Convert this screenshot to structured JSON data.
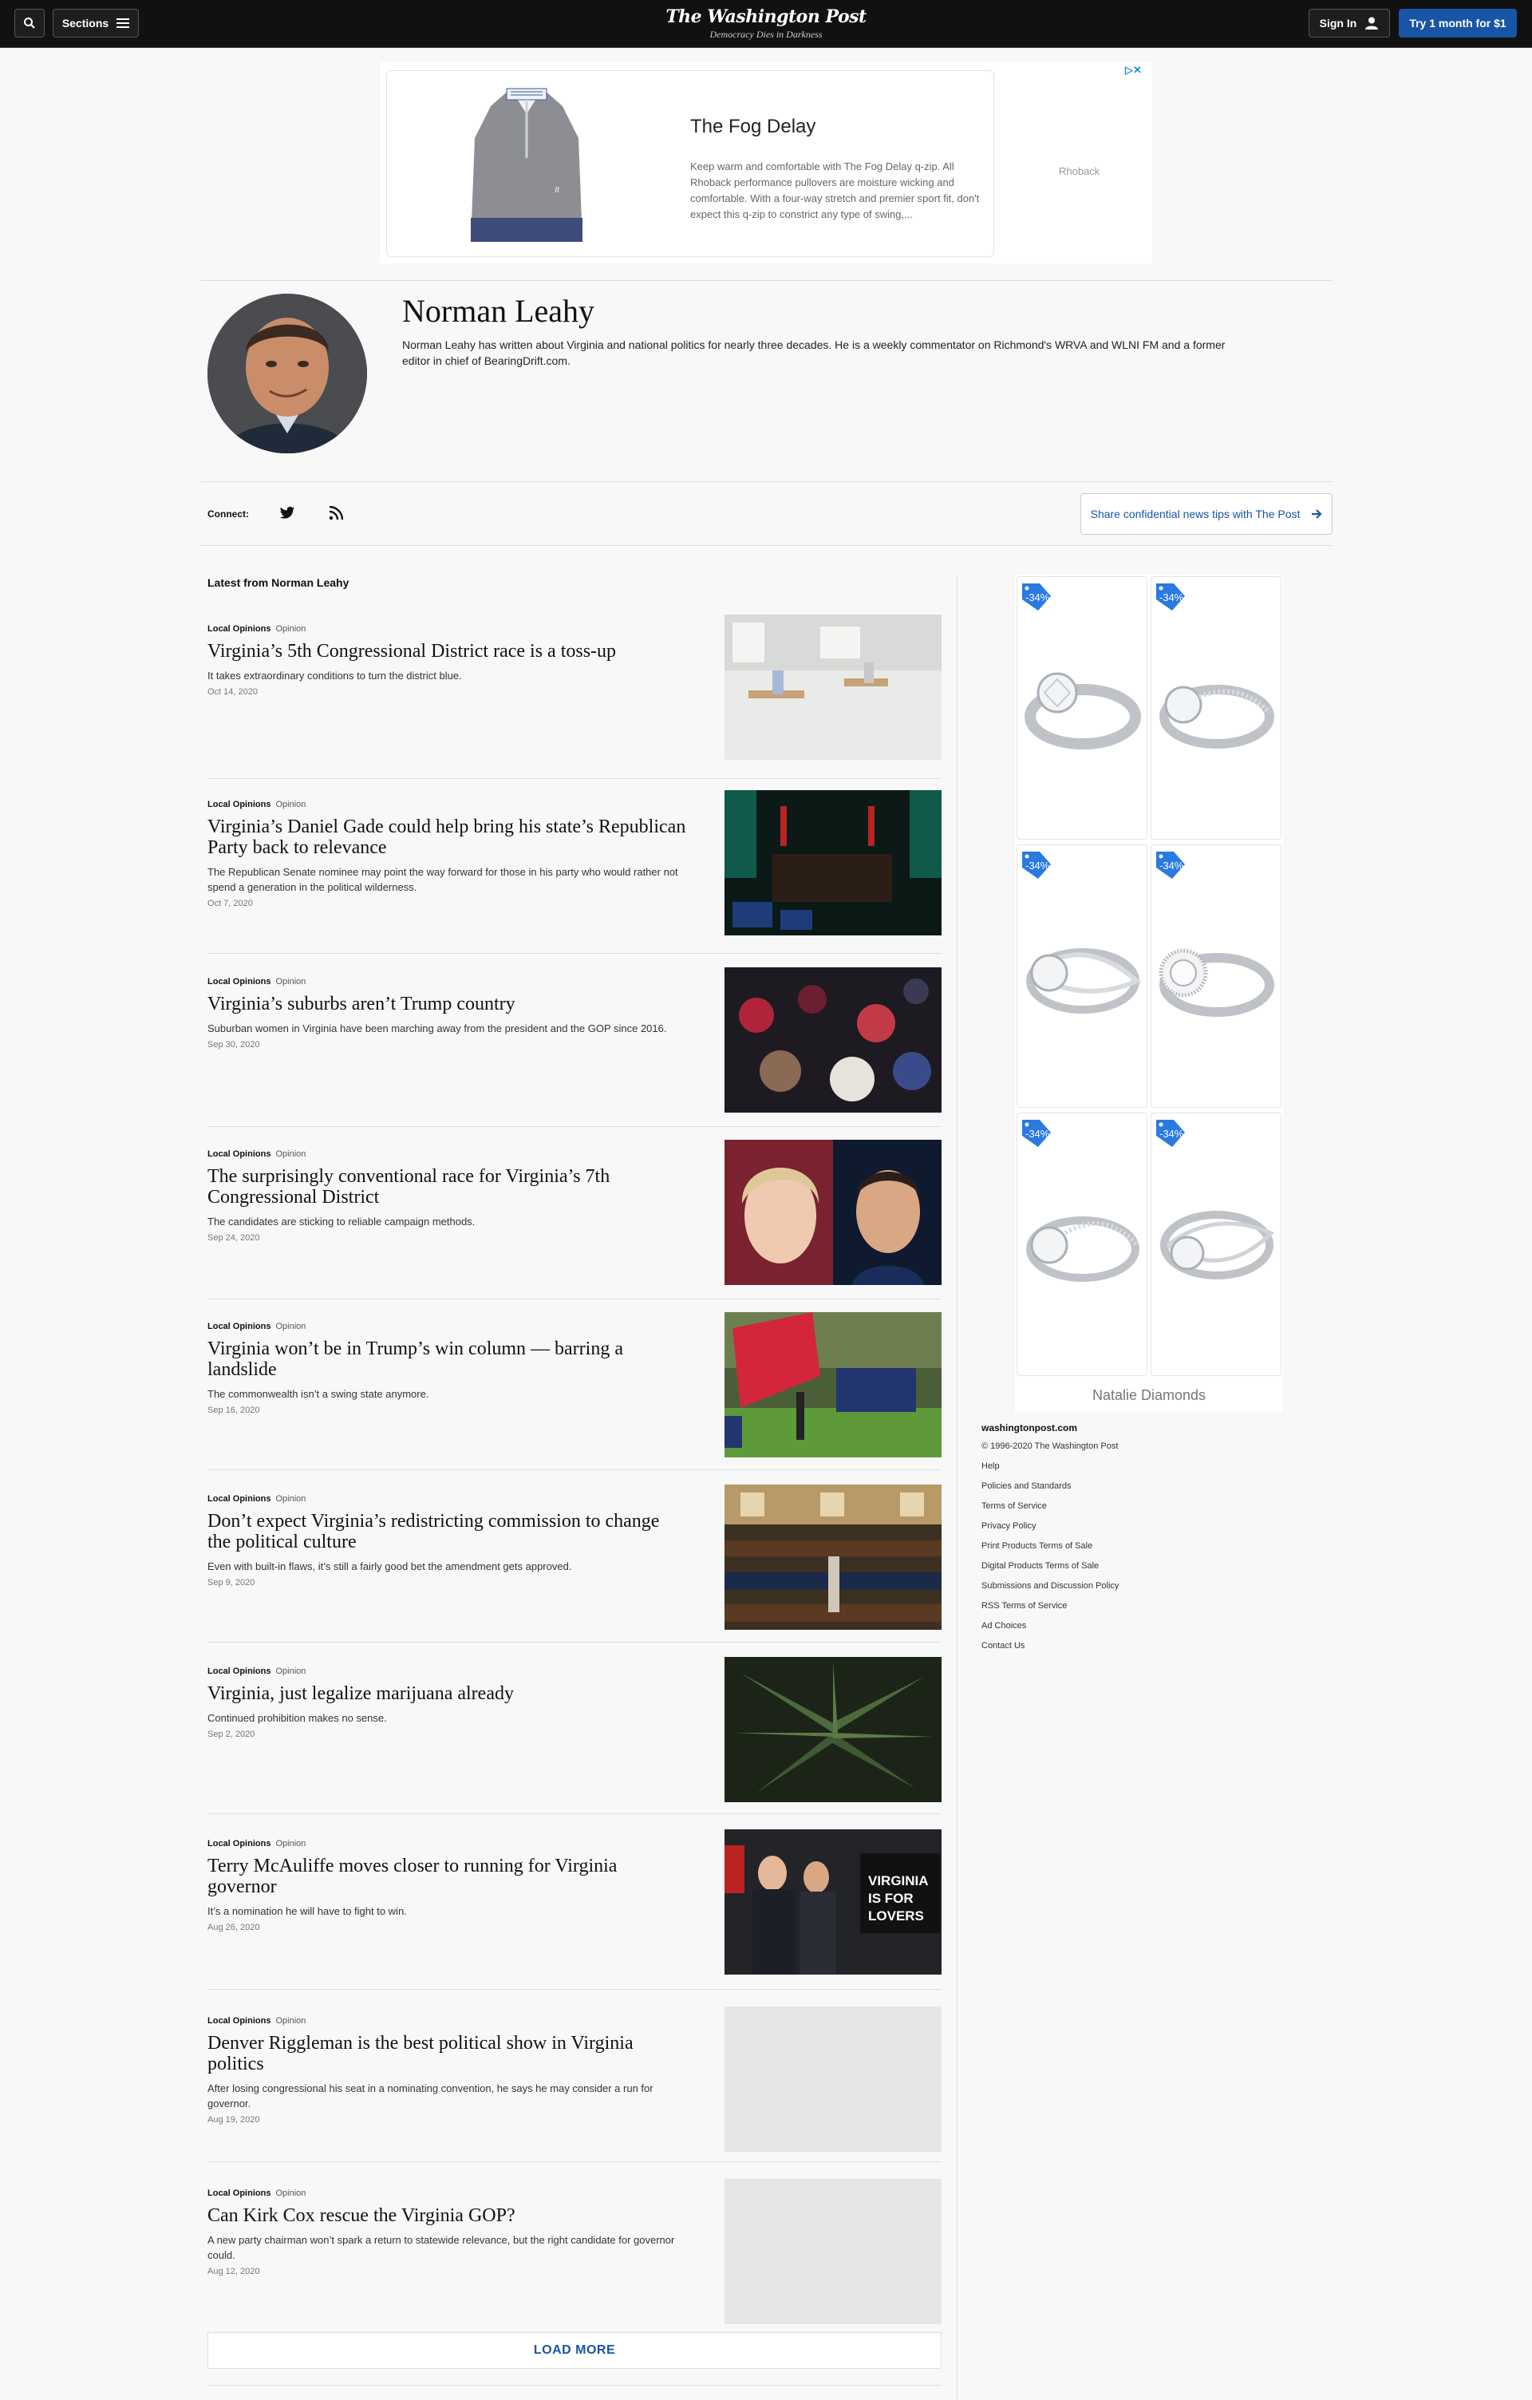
{
  "header": {
    "sections_label": "Sections",
    "logo_name": "The Washington Post",
    "logo_tagline": "Democracy Dies in Darkness",
    "signin_label": "Sign In",
    "try_label": "Try 1 month for $1"
  },
  "top_ad": {
    "title": "The Fog Delay",
    "description": "Keep warm and comfortable with The Fog Delay q-zip. All Rhoback performance pullovers are moisture wicking and comfortable. With a four-way stretch and premier sport fit, don't expect this q-zip to constrict any type of swing,...",
    "brand": "Rhoback"
  },
  "author": {
    "name": "Norman Leahy",
    "bio": "Norman Leahy has written about Virginia and national politics for nearly three decades. He is a weekly commentator on Richmond's WRVA and WLNI FM and a former editor in chief of BearingDrift.com."
  },
  "connect": {
    "label": "Connect:",
    "tips_label": "Share confidential news tips with The Post"
  },
  "latest_heading": "Latest from Norman Leahy",
  "articles": [
    {
      "section": "Local Opinions",
      "kind": "Opinion",
      "headline": "Virginia’s 5th Congressional District race is a toss-up",
      "blurb": "It takes extraordinary conditions to turn the district blue.",
      "date": "Oct 14, 2020"
    },
    {
      "section": "Local Opinions",
      "kind": "Opinion",
      "headline": "Virginia’s Daniel Gade could help bring his state’s Republican Party back to relevance",
      "blurb": "The Republican Senate nominee may point the way forward for those in his party who would rather not spend a generation in the political wilderness.",
      "date": "Oct 7, 2020"
    },
    {
      "section": "Local Opinions",
      "kind": "Opinion",
      "headline": "Virginia’s suburbs aren’t Trump country",
      "blurb": "Suburban women in Virginia have been marching away from the president and the GOP since 2016.",
      "date": "Sep 30, 2020"
    },
    {
      "section": "Local Opinions",
      "kind": "Opinion",
      "headline": "The surprisingly conventional race for Virginia’s 7th Congressional District",
      "blurb": "The candidates are sticking to reliable campaign methods.",
      "date": "Sep 24, 2020"
    },
    {
      "section": "Local Opinions",
      "kind": "Opinion",
      "headline": "Virginia won’t be in Trump’s win column — barring a landslide",
      "blurb": "The commonwealth isn’t a swing state anymore.",
      "date": "Sep 16, 2020"
    },
    {
      "section": "Local Opinions",
      "kind": "Opinion",
      "headline": "Don’t expect Virginia’s redistricting commission to change the political culture",
      "blurb": "Even with built-in flaws, it’s still a fairly good bet the amendment gets approved.",
      "date": "Sep 9, 2020"
    },
    {
      "section": "Local Opinions",
      "kind": "Opinion",
      "headline": "Virginia, just legalize marijuana already",
      "blurb": "Continued prohibition makes no sense.",
      "date": "Sep 2, 2020"
    },
    {
      "section": "Local Opinions",
      "kind": "Opinion",
      "headline": "Terry McAuliffe moves closer to running for Virginia governor",
      "blurb": "It’s a nomination he will have to fight to win.",
      "date": "Aug 26, 2020"
    },
    {
      "section": "Local Opinions",
      "kind": "Opinion",
      "headline": "Denver Riggleman is the best political show in Virginia politics",
      "blurb": "After losing congressional his seat in a nominating convention, he says he may consider a run for governor.",
      "date": "Aug 19, 2020"
    },
    {
      "section": "Local Opinions",
      "kind": "Opinion",
      "headline": "Can Kirk Cox rescue the Virginia GOP?",
      "blurb": "A new party chairman won’t spark a return to statewide relevance, but the right candidate for governor could.",
      "date": "Aug 12, 2020"
    }
  ],
  "load_more_label": "LOAD MORE",
  "right_ad": {
    "badge_text": "-34%",
    "brand": "Natalie Diamonds"
  },
  "footer": {
    "site": "washingtonpost.com",
    "copyright": "© 1996-2020 The Washington Post",
    "links": [
      "Help",
      "Policies and Standards",
      "Terms of Service",
      "Privacy Policy",
      "Print Products Terms of Sale",
      "Digital Products Terms of Sale",
      "Submissions and Discussion Policy",
      "RSS Terms of Service",
      "Ad Choices",
      "Contact Us"
    ]
  },
  "colors": {
    "accent": "#1955a5",
    "topbar": "#111111",
    "badge": "#2a7ae2"
  },
  "icons": [
    "search-icon",
    "menu-icon",
    "user-icon",
    "twitter-icon",
    "rss-icon",
    "arrow-right-icon",
    "ad-choices-icon",
    "discount-tag-icon"
  ]
}
